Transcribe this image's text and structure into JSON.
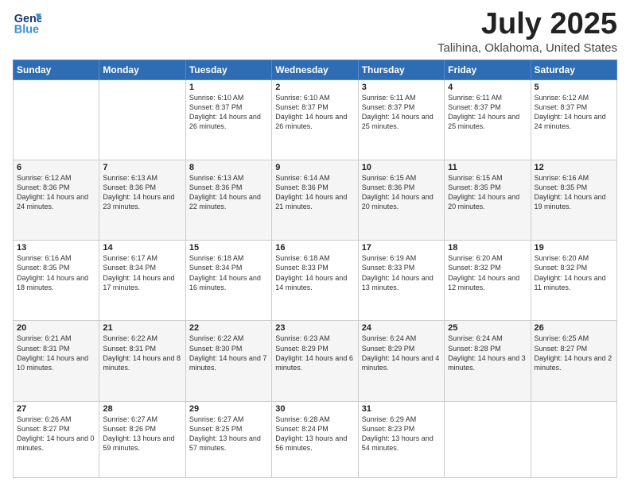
{
  "header": {
    "logo_general": "General",
    "logo_blue": "Blue",
    "month": "July 2025",
    "location": "Talihina, Oklahoma, United States"
  },
  "days_of_week": [
    "Sunday",
    "Monday",
    "Tuesday",
    "Wednesday",
    "Thursday",
    "Friday",
    "Saturday"
  ],
  "weeks": [
    [
      {
        "day": "",
        "content": ""
      },
      {
        "day": "",
        "content": ""
      },
      {
        "day": "1",
        "content": "Sunrise: 6:10 AM\nSunset: 8:37 PM\nDaylight: 14 hours\nand 26 minutes."
      },
      {
        "day": "2",
        "content": "Sunrise: 6:10 AM\nSunset: 8:37 PM\nDaylight: 14 hours\nand 26 minutes."
      },
      {
        "day": "3",
        "content": "Sunrise: 6:11 AM\nSunset: 8:37 PM\nDaylight: 14 hours\nand 25 minutes."
      },
      {
        "day": "4",
        "content": "Sunrise: 6:11 AM\nSunset: 8:37 PM\nDaylight: 14 hours\nand 25 minutes."
      },
      {
        "day": "5",
        "content": "Sunrise: 6:12 AM\nSunset: 8:37 PM\nDaylight: 14 hours\nand 24 minutes."
      }
    ],
    [
      {
        "day": "6",
        "content": "Sunrise: 6:12 AM\nSunset: 8:36 PM\nDaylight: 14 hours\nand 24 minutes."
      },
      {
        "day": "7",
        "content": "Sunrise: 6:13 AM\nSunset: 8:36 PM\nDaylight: 14 hours\nand 23 minutes."
      },
      {
        "day": "8",
        "content": "Sunrise: 6:13 AM\nSunset: 8:36 PM\nDaylight: 14 hours\nand 22 minutes."
      },
      {
        "day": "9",
        "content": "Sunrise: 6:14 AM\nSunset: 8:36 PM\nDaylight: 14 hours\nand 21 minutes."
      },
      {
        "day": "10",
        "content": "Sunrise: 6:15 AM\nSunset: 8:36 PM\nDaylight: 14 hours\nand 20 minutes."
      },
      {
        "day": "11",
        "content": "Sunrise: 6:15 AM\nSunset: 8:35 PM\nDaylight: 14 hours\nand 20 minutes."
      },
      {
        "day": "12",
        "content": "Sunrise: 6:16 AM\nSunset: 8:35 PM\nDaylight: 14 hours\nand 19 minutes."
      }
    ],
    [
      {
        "day": "13",
        "content": "Sunrise: 6:16 AM\nSunset: 8:35 PM\nDaylight: 14 hours\nand 18 minutes."
      },
      {
        "day": "14",
        "content": "Sunrise: 6:17 AM\nSunset: 8:34 PM\nDaylight: 14 hours\nand 17 minutes."
      },
      {
        "day": "15",
        "content": "Sunrise: 6:18 AM\nSunset: 8:34 PM\nDaylight: 14 hours\nand 16 minutes."
      },
      {
        "day": "16",
        "content": "Sunrise: 6:18 AM\nSunset: 8:33 PM\nDaylight: 14 hours\nand 14 minutes."
      },
      {
        "day": "17",
        "content": "Sunrise: 6:19 AM\nSunset: 8:33 PM\nDaylight: 14 hours\nand 13 minutes."
      },
      {
        "day": "18",
        "content": "Sunrise: 6:20 AM\nSunset: 8:32 PM\nDaylight: 14 hours\nand 12 minutes."
      },
      {
        "day": "19",
        "content": "Sunrise: 6:20 AM\nSunset: 8:32 PM\nDaylight: 14 hours\nand 11 minutes."
      }
    ],
    [
      {
        "day": "20",
        "content": "Sunrise: 6:21 AM\nSunset: 8:31 PM\nDaylight: 14 hours\nand 10 minutes."
      },
      {
        "day": "21",
        "content": "Sunrise: 6:22 AM\nSunset: 8:31 PM\nDaylight: 14 hours\nand 8 minutes."
      },
      {
        "day": "22",
        "content": "Sunrise: 6:22 AM\nSunset: 8:30 PM\nDaylight: 14 hours\nand 7 minutes."
      },
      {
        "day": "23",
        "content": "Sunrise: 6:23 AM\nSunset: 8:29 PM\nDaylight: 14 hours\nand 6 minutes."
      },
      {
        "day": "24",
        "content": "Sunrise: 6:24 AM\nSunset: 8:29 PM\nDaylight: 14 hours\nand 4 minutes."
      },
      {
        "day": "25",
        "content": "Sunrise: 6:24 AM\nSunset: 8:28 PM\nDaylight: 14 hours\nand 3 minutes."
      },
      {
        "day": "26",
        "content": "Sunrise: 6:25 AM\nSunset: 8:27 PM\nDaylight: 14 hours\nand 2 minutes."
      }
    ],
    [
      {
        "day": "27",
        "content": "Sunrise: 6:26 AM\nSunset: 8:27 PM\nDaylight: 14 hours\nand 0 minutes."
      },
      {
        "day": "28",
        "content": "Sunrise: 6:27 AM\nSunset: 8:26 PM\nDaylight: 13 hours\nand 59 minutes."
      },
      {
        "day": "29",
        "content": "Sunrise: 6:27 AM\nSunset: 8:25 PM\nDaylight: 13 hours\nand 57 minutes."
      },
      {
        "day": "30",
        "content": "Sunrise: 6:28 AM\nSunset: 8:24 PM\nDaylight: 13 hours\nand 56 minutes."
      },
      {
        "day": "31",
        "content": "Sunrise: 6:29 AM\nSunset: 8:23 PM\nDaylight: 13 hours\nand 54 minutes."
      },
      {
        "day": "",
        "content": ""
      },
      {
        "day": "",
        "content": ""
      }
    ]
  ]
}
